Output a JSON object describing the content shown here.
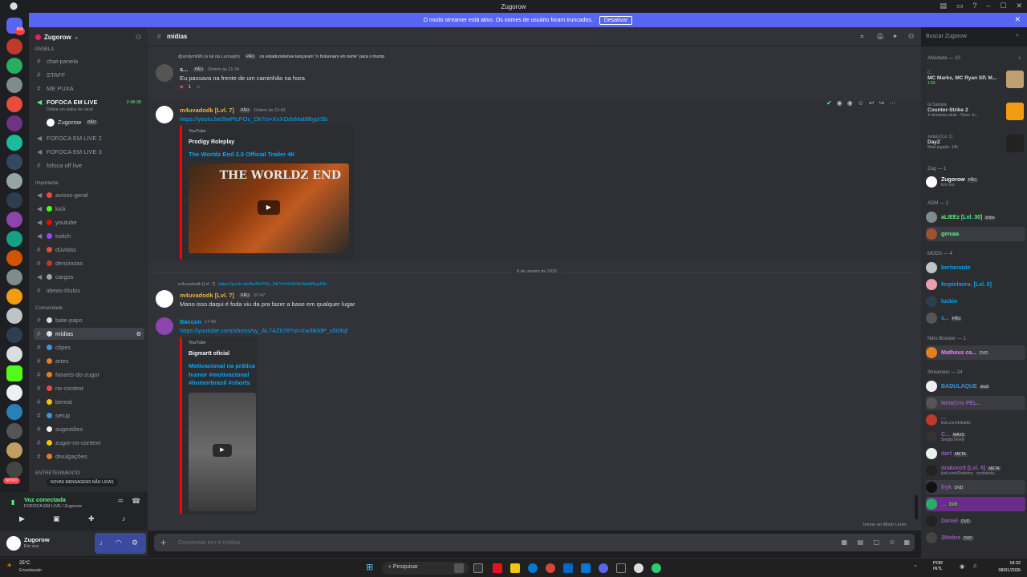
{
  "window": {
    "title": "Zugorow"
  },
  "banner": {
    "text": "O modo streamer está ativo. Os nomes de usuário foram truncados.",
    "button": "Desativar"
  },
  "server": {
    "name": "Zugorow"
  },
  "channels": {
    "cat_panela": "PANELA",
    "items_top": [
      "chat-panela",
      "STAFF",
      "ME PUXA"
    ],
    "live": {
      "name": "FOFOCA EM LIVE",
      "time": "2:48:38",
      "sub": "Defina um status do canal",
      "user": "Zugorow",
      "user_tag": "PÃO"
    },
    "items_live": [
      "FOFOCA EM LIVE 2",
      "FOFOCA EM LIVE 3",
      "fofoca off live"
    ],
    "cat_importante": "Importante",
    "importante": [
      "avisos-geral",
      "kick",
      "youtube",
      "twitch",
      "dúvidas",
      "denúncias",
      "cargos",
      "ideias-títulos"
    ],
    "cat_comunidade": "Comunidade",
    "comunidade": [
      "bate-papo",
      "mídias",
      "clipes",
      "artes",
      "fanarts-do-zugor",
      "no-context",
      "bereal",
      "setup",
      "sugestões",
      "zugor-no-context",
      "divulgações"
    ],
    "cat_entretenimento": "ENTRETENIMENTO",
    "new_msgs": "NOVAS MENSAGENS NÃO LIDAS",
    "novo": "NOVO"
  },
  "voice": {
    "status": "Voz conectada",
    "channel": "FOFOCA EM LIVE / Zugorow"
  },
  "user": {
    "name": "Zugorow",
    "status": "Em voz"
  },
  "header": {
    "channel": "mídias",
    "search_placeholder": "Buscar Zugorow"
  },
  "messages": {
    "m1": {
      "reply": "@andymil96 (a tal da Lunnaph)",
      "reply_tag": "PÃO",
      "reply_text": "os estadunidense lançaram \"o bolsonaro eh norte\" para o trump",
      "author": "s...",
      "tag": "PÃO",
      "time": "Ontem às 21:34",
      "text": "Eu passava na frente de um caminhão na hora",
      "reaction_count": "1"
    },
    "m2": {
      "author": "m4uvadodk [Lvl. 7]",
      "tag": "PÃO",
      "time": "Ontem às 21:42",
      "link": "https://youtu.be/9wPtcPOc_Dk?si=XxXOdxMat6BypISb",
      "embed": {
        "provider": "YouTube",
        "author": "Prodigy Roleplay",
        "title": "The Worldz End 2.0 Official Trailer 4K",
        "thumb_text": "THE WORLDZ END"
      }
    },
    "date_divider": "8 de janeiro de 2026",
    "m3": {
      "reply": "m4uvadodk [Lvl. 7]",
      "reply_text": "https://youtu.be/9wPtcPOc_Dk?si=XxXOdxMat6BypISb",
      "author": "m4uvadodk [Lvl. 7]",
      "tag": "PÃO",
      "time": "07:47",
      "text": "Mano isso daqui é foda viu da pra fazer a base em qualquer lugar"
    },
    "m4": {
      "author": "Baccon",
      "time": "17:43",
      "link": "https://youtube.com/shorts/sy_AL7AZ078?si=Xw3tkfdP_s5i0fqf",
      "embed": {
        "provider": "YouTube",
        "author": "Bigmartt oficial",
        "title": "Motivacional na prática humor #motivacional #humorbrasil #shorts"
      }
    },
    "slowmode": "Imune ao Modo Lento"
  },
  "input": {
    "placeholder": "Conversar em # mídias"
  },
  "members": {
    "activity_title": "Atividade — 10",
    "activities": [
      {
        "user": "C...",
        "title": "MC Marks, MC Ryan SP, M...",
        "sub": "1:55"
      },
      {
        "user": "Gl Santata",
        "title": "Counter-Strike 2",
        "sub": "4 semanas atrás · Novo Jo..."
      },
      {
        "user": "JottaG [Lvl. 1]",
        "title": "DayZ",
        "sub": "Mais jogado: 14h"
      }
    ],
    "groups": [
      {
        "label": "Zug — 1",
        "members": [
          {
            "name": "Zugorow",
            "tag": "PÃO",
            "sub": "Em voz",
            "color": "#f2f3f5"
          }
        ]
      },
      {
        "label": "ADM — 2",
        "members": [
          {
            "name": "aLIEEz [Lvl. 30]",
            "tag": "bobo",
            "color": "#57f287"
          },
          {
            "name": "geniaa",
            "tag": "",
            "color": "#57f287"
          }
        ]
      },
      {
        "label": "MODS — 4",
        "members": [
          {
            "name": "bertocouto",
            "color": "#00a8fc"
          },
          {
            "name": "ferpinheiro. [Lvl. 0]",
            "color": "#00a8fc"
          },
          {
            "name": "luckin",
            "color": "#00a8fc"
          },
          {
            "name": "s...",
            "tag": "PÃO",
            "color": "#00a8fc"
          }
        ]
      },
      {
        "label": "Nitro Booster — 1",
        "members": [
          {
            "name": "Matheus ca...",
            "tag": "DVD",
            "color": "#f47fff"
          }
        ]
      },
      {
        "label": "Streamers — 24",
        "members": [
          {
            "name": "BADULAQUE",
            "tag": "skull",
            "color": "#3498db"
          },
          {
            "name": "NetaCris PEL...",
            "color": "#9b59b6"
          },
          {
            "name": "...",
            "sub": "kick.com/bleatks",
            "color": "#9b59b6"
          },
          {
            "name": "C...",
            "tag": "MAX3",
            "sub": "Simply lovely",
            "color": "#9b59b6"
          },
          {
            "name": "dart",
            "tag": "META",
            "color": "#9b59b6"
          },
          {
            "name": "drakonz9 [Lvl. 8]",
            "tag": "META",
            "sub": "kick.com/Drakonz · contatoda...",
            "color": "#9b59b6"
          },
          {
            "name": "fryk",
            "tag": "DVD",
            "color": "#9b59b6"
          },
          {
            "name": "...",
            "tag": "DVD",
            "color": "#9b59b6"
          },
          {
            "name": "Daniel",
            "tag": "DVD",
            "color": "#9b59b6"
          },
          {
            "name": "2Nobre",
            "tag": "DVD",
            "color": "#9b59b6"
          }
        ]
      }
    ]
  },
  "taskbar": {
    "search": "Pesquisar",
    "weather_temp": "25°C",
    "weather_text": "Ensolarado",
    "lang": "POR INTL",
    "time": "18:32",
    "date": "08/01/2026"
  }
}
